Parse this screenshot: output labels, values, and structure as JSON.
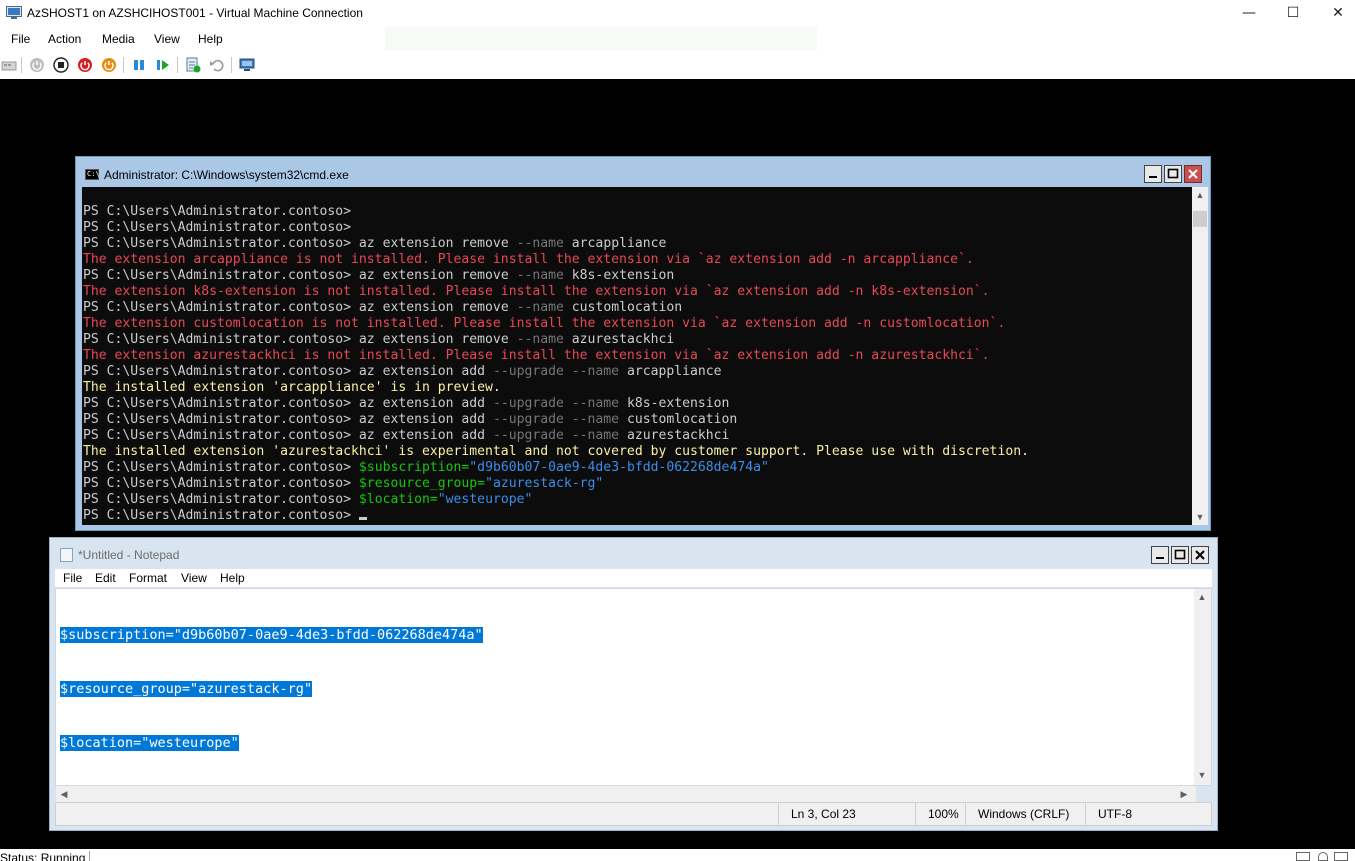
{
  "window": {
    "title": "AzSHOST1 on AZSHCIHOST001 - Virtual Machine Connection",
    "minimize": "—",
    "maximize": "☐",
    "close": "✕"
  },
  "menu": [
    "File",
    "Action",
    "Media",
    "View",
    "Help"
  ],
  "toolbar_icons": [
    "ctrl-alt-del-icon",
    "start-icon",
    "turn-off-icon",
    "shutdown-icon",
    "save-icon",
    "pause-icon",
    "resume-icon",
    "checkpoint-icon",
    "revert-icon",
    "enhanced-session-icon"
  ],
  "cmd": {
    "title": "Administrator: C:\\Windows\\system32\\cmd.exe",
    "icon_label": "C:\\",
    "prompt": "PS C:\\Users\\Administrator.contoso>",
    "lines": [
      [
        {
          "t": "PS C:\\Users\\Administrator.contoso>",
          "c": "w"
        }
      ],
      [
        {
          "t": "PS C:\\Users\\Administrator.contoso>",
          "c": "w"
        }
      ],
      [
        {
          "t": "PS C:\\Users\\Administrator.contoso> ",
          "c": "w"
        },
        {
          "t": "az extension remove ",
          "c": "w"
        },
        {
          "t": "--name ",
          "c": "k"
        },
        {
          "t": "arcappliance",
          "c": "w"
        }
      ],
      [
        {
          "t": "The extension arcappliance is not installed. Please install the extension via `az extension add -n arcappliance`.",
          "c": "r"
        }
      ],
      [
        {
          "t": "PS C:\\Users\\Administrator.contoso> ",
          "c": "w"
        },
        {
          "t": "az extension remove ",
          "c": "w"
        },
        {
          "t": "--name ",
          "c": "k"
        },
        {
          "t": "k8s-extension",
          "c": "w"
        }
      ],
      [
        {
          "t": "The extension k8s-extension is not installed. Please install the extension via `az extension add -n k8s-extension`.",
          "c": "r"
        }
      ],
      [
        {
          "t": "PS C:\\Users\\Administrator.contoso> ",
          "c": "w"
        },
        {
          "t": "az extension remove ",
          "c": "w"
        },
        {
          "t": "--name ",
          "c": "k"
        },
        {
          "t": "customlocation",
          "c": "w"
        }
      ],
      [
        {
          "t": "The extension customlocation is not installed. Please install the extension via `az extension add -n customlocation`.",
          "c": "r"
        }
      ],
      [
        {
          "t": "PS C:\\Users\\Administrator.contoso> ",
          "c": "w"
        },
        {
          "t": "az extension remove ",
          "c": "w"
        },
        {
          "t": "--name ",
          "c": "k"
        },
        {
          "t": "azurestackhci",
          "c": "w"
        }
      ],
      [
        {
          "t": "The extension azurestackhci is not installed. Please install the extension via `az extension add -n azurestackhci`.",
          "c": "r"
        }
      ],
      [
        {
          "t": "PS C:\\Users\\Administrator.contoso> ",
          "c": "w"
        },
        {
          "t": "az extension add ",
          "c": "w"
        },
        {
          "t": "--upgrade --name ",
          "c": "k"
        },
        {
          "t": "arcappliance",
          "c": "w"
        }
      ],
      [
        {
          "t": "The installed extension 'arcappliance' is in preview.",
          "c": "y"
        }
      ],
      [
        {
          "t": "PS C:\\Users\\Administrator.contoso> ",
          "c": "w"
        },
        {
          "t": "az extension add ",
          "c": "w"
        },
        {
          "t": "--upgrade --name ",
          "c": "k"
        },
        {
          "t": "k8s-extension",
          "c": "w"
        }
      ],
      [
        {
          "t": "PS C:\\Users\\Administrator.contoso> ",
          "c": "w"
        },
        {
          "t": "az extension add ",
          "c": "w"
        },
        {
          "t": "--upgrade --name ",
          "c": "k"
        },
        {
          "t": "customlocation",
          "c": "w"
        }
      ],
      [
        {
          "t": "PS C:\\Users\\Administrator.contoso> ",
          "c": "w"
        },
        {
          "t": "az extension add ",
          "c": "w"
        },
        {
          "t": "--upgrade --name ",
          "c": "k"
        },
        {
          "t": "azurestackhci",
          "c": "w"
        }
      ],
      [
        {
          "t": "The installed extension 'azurestackhci' is experimental and not covered by customer support. Please use with discretion.",
          "c": "y"
        }
      ],
      [
        {
          "t": "PS C:\\Users\\Administrator.contoso> ",
          "c": "w"
        },
        {
          "t": "$subscription=",
          "c": "g"
        },
        {
          "t": "\"d9b60b07-0ae9-4de3-bfdd-062268de474a\"",
          "c": "b"
        }
      ],
      [
        {
          "t": "PS C:\\Users\\Administrator.contoso> ",
          "c": "w"
        },
        {
          "t": "$resource_group=",
          "c": "g"
        },
        {
          "t": "\"azurestack-rg\"",
          "c": "b"
        }
      ],
      [
        {
          "t": "PS C:\\Users\\Administrator.contoso> ",
          "c": "w"
        },
        {
          "t": "$location=",
          "c": "g"
        },
        {
          "t": "\"westeurope\"",
          "c": "b"
        }
      ],
      [
        {
          "t": "PS C:\\Users\\Administrator.contoso> ",
          "c": "w"
        }
      ]
    ]
  },
  "notepad": {
    "title": "*Untitled - Notepad",
    "menu": [
      "File",
      "Edit",
      "Format",
      "View",
      "Help"
    ],
    "content": [
      "$subscription=\"d9b60b07-0ae9-4de3-bfdd-062268de474a\"",
      "$resource_group=\"azurestack-rg\"",
      "$location=\"westeurope\""
    ],
    "status": {
      "position": "Ln 3, Col 23",
      "zoom": "100%",
      "line_ending": "Windows (CRLF)",
      "encoding": "UTF-8"
    }
  },
  "vm_status": "Status: Running",
  "colors": {
    "console_bg": "#0c0c0c",
    "error": "#e74856",
    "warning": "#f9f1a5",
    "variable": "#16c60c",
    "string": "#3b8eea",
    "selection": "#0078d7"
  }
}
